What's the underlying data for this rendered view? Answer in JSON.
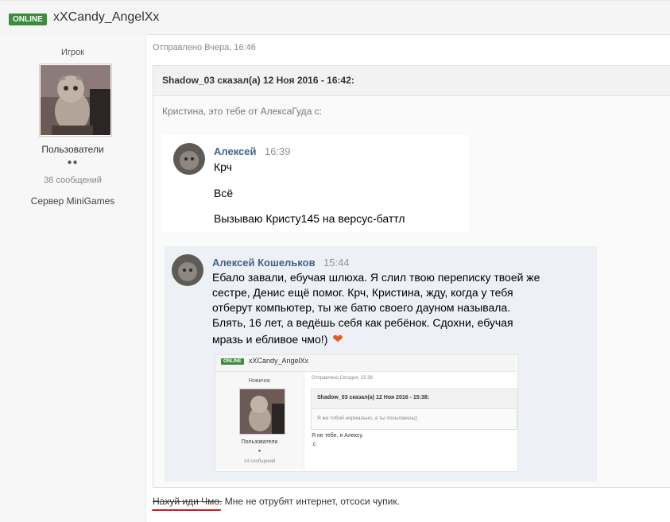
{
  "header": {
    "status_badge": "ONLINE",
    "username": "xXCandy_AngelXx"
  },
  "author": {
    "rank": "Игрок",
    "group": "Пользователи",
    "rating_dots": "●●",
    "posts": "38 сообщений",
    "server": "Сервер MiniGames"
  },
  "post": {
    "sent_time": "Отправлено Вчера, 16:46",
    "quote_header": "Shadow_03 сказал(а) 12 Ноя 2016 - 16:42:",
    "quote_intro": "Кристина, это тебе от АлексаГуда с:",
    "vk_message_1": {
      "name": "Алексей",
      "time": "16:39",
      "lines": [
        "Крч",
        "Всё",
        "Вызываю Кристу145 на версус-баттл"
      ]
    },
    "vk_message_2": {
      "name": "Алексей Кошельков",
      "time": "15:44",
      "lines": [
        "Ебало завали, ебучая шлюха. Я слил твою переписку твоей же",
        "сестре, Денис ещё помог. Крч, Кристина, жду, когда у тебя",
        "отберут компьютер, ты же батю своего дауном называла.",
        "Блять, 16 лет, а ведёшь себя как ребёнок. Сдохни, ебучая",
        "мразь и ебливое чмо!)"
      ],
      "emoji": "❤"
    },
    "reply_strike": "Нахуй иди Чмо.",
    "reply_text": " Мне не отрубят интернет, отсоси чупик."
  },
  "nested_screenshot": {
    "status_badge": "ONLINE",
    "username": "xXCandy_AngelXx",
    "rank": "Новичок",
    "sent_time": "Отправлено Сегодня, 15:39",
    "quote_header": "Shadow_03 сказал(а) 12 Ноя 2016 - 15:38:",
    "quote_body": "Я же тобой нормально, а ты посылаешь((",
    "reply_line_1": "Я не тебе, я Алексу.",
    "reply_line_2": ":c",
    "group": "Пользователи",
    "rating_dots": "●",
    "posts": "14 сообщений"
  },
  "colors": {
    "online_green": "#3d8b3d",
    "vk_name_blue": "#42648b",
    "underline_red": "#d11a1a"
  }
}
